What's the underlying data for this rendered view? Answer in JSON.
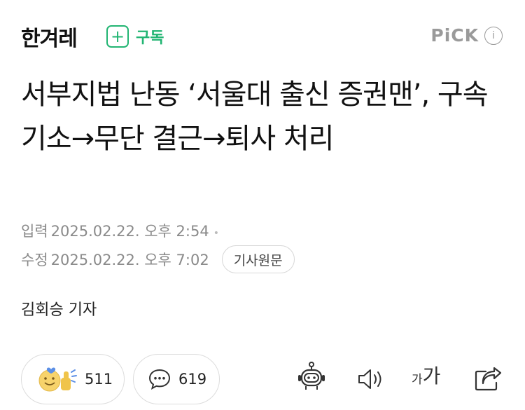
{
  "header": {
    "logo": "한겨레",
    "subscribe_label": "구독",
    "subscribe_icon": "plus-icon",
    "pick_label": "PiCK",
    "info_icon_glyph": "i",
    "accent_color": "#22b573"
  },
  "article": {
    "title": "서부지법 난동 ‘서울대 출신 증권맨’, 구속 기소→무단 결근→퇴사 처리",
    "input_label": "입력",
    "input_time": "2025.02.22. 오후 2:54",
    "edit_label": "수정",
    "edit_time": "2025.02.22. 오후 7:02",
    "original_button": "기사원문",
    "reporter": "김회승 기자"
  },
  "actions": {
    "reaction_count": "511",
    "comment_count": "619",
    "font_small": "가",
    "font_large": "가",
    "icons": [
      "reaction-emoji-icon",
      "comment-bubble-icon",
      "robot-summary-icon",
      "speaker-icon",
      "font-size-icon",
      "share-icon"
    ]
  }
}
